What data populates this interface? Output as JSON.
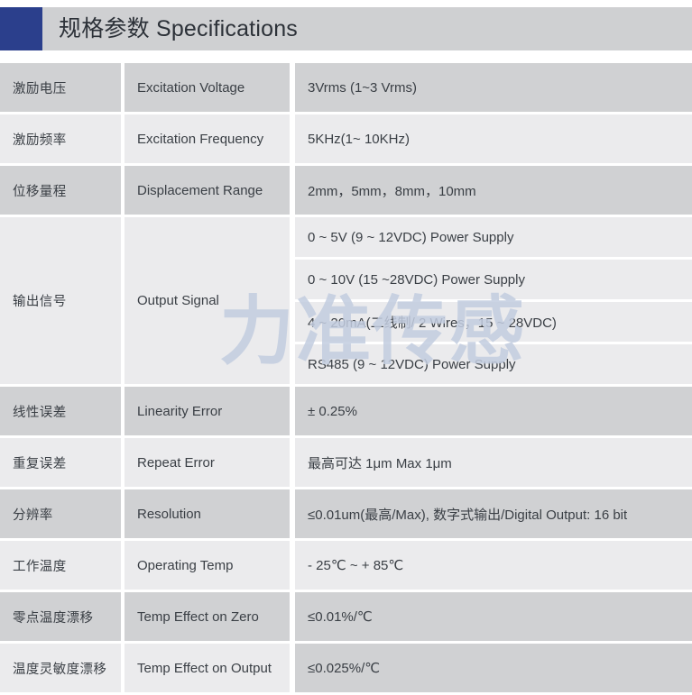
{
  "header": {
    "title": "规格参数 Specifications",
    "accent_color": "#2b3f8c",
    "band_color": "#cfd0d2"
  },
  "watermark": {
    "text": "力准传感",
    "color": "#c3cde0"
  },
  "palette": {
    "row_dark": "#d0d1d3",
    "row_light": "#ebebed",
    "text": "#3a3f45"
  },
  "table": {
    "rows": [
      {
        "cn": "激励电压",
        "en": "Excitation Voltage",
        "value": "3Vrms (1~3 Vrms)",
        "shade": "dark"
      },
      {
        "cn": "激励频率",
        "en": "Excitation Frequency",
        "value": "5KHz(1~ 10KHz)",
        "shade": "light"
      },
      {
        "cn": "位移量程",
        "en": "Displacement Range",
        "value": "2mm，5mm，8mm，10mm",
        "shade": "dark"
      },
      {
        "cn": "输出信号",
        "en": "Output Signal",
        "shade": "light",
        "values": [
          "0 ~ 5V (9 ~ 12VDC) Power Supply",
          "0 ~ 10V (15 ~28VDC) Power Supply",
          "4 ~ 20mA(二线制/ 2 Wires，15 ~ 28VDC)",
          "RS485 (9 ~ 12VDC) Power Supply"
        ]
      },
      {
        "cn": "线性误差",
        "en": "Linearity Error",
        "value": "± 0.25%",
        "shade": "dark"
      },
      {
        "cn": "重复误差",
        "en": "Repeat Error",
        "value": "最高可达 1μm   Max 1μm",
        "shade": "light"
      },
      {
        "cn": "分辨率",
        "en": "Resolution",
        "value": "≤0.01um(最高/Max), 数字式输出/Digital Output: 16 bit",
        "shade": "dark"
      },
      {
        "cn": "工作温度",
        "en": "Operating Temp",
        "value": "- 25℃ ~ + 85℃",
        "shade": "light"
      },
      {
        "cn": "零点温度漂移",
        "en": "Temp Effect on Zero",
        "value": "≤0.01%/℃",
        "shade": "dark"
      },
      {
        "cn": "温度灵敏度漂移",
        "en": "Temp Effect on Output",
        "value": "≤0.025%/℃",
        "shade": "light",
        "value_shade": "dark"
      }
    ]
  }
}
